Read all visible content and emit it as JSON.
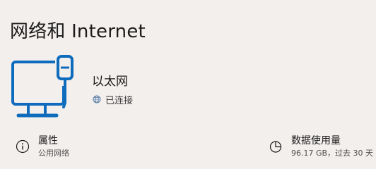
{
  "page": {
    "title": "网络和 Internet"
  },
  "network": {
    "icon": "ethernet-monitor-icon",
    "name": "以太网",
    "status_icon": "globe-icon",
    "status": "已连接"
  },
  "tiles": [
    {
      "icon": "info-circle-icon",
      "title": "属性",
      "subtitle": "公用网络"
    },
    {
      "icon": "pie-chart-icon",
      "title": "数据使用量",
      "subtitle": "96.17 GB，过去 30 天"
    }
  ],
  "colors": {
    "background": "#f3efed",
    "accent": "#0f6cbd",
    "text": "#1b1b1b"
  }
}
